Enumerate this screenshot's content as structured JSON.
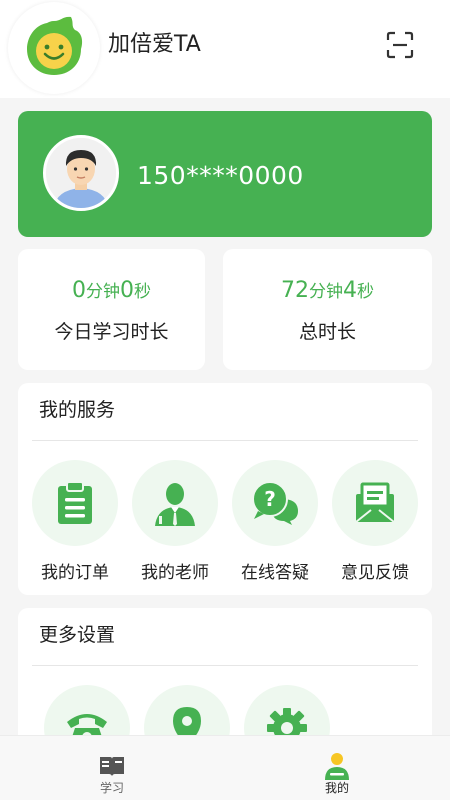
{
  "header": {
    "app_title": "加倍爱TA",
    "scan_icon": "scan-icon"
  },
  "profile": {
    "phone": "150****0000",
    "avatar_icon": "user-avatar"
  },
  "stats": {
    "today": {
      "minutes": "0",
      "minutes_unit": "分钟",
      "seconds": "0",
      "seconds_unit": "秒",
      "label": "今日学习时长"
    },
    "total": {
      "minutes": "72",
      "minutes_unit": "分钟",
      "seconds": "4",
      "seconds_unit": "秒",
      "label": "总时长"
    }
  },
  "services": {
    "title": "我的服务",
    "items": [
      {
        "label": "我的订单",
        "icon": "clipboard-icon"
      },
      {
        "label": "我的老师",
        "icon": "teacher-icon"
      },
      {
        "label": "在线答疑",
        "icon": "question-chat-icon"
      },
      {
        "label": "意见反馈",
        "icon": "feedback-mail-icon"
      }
    ]
  },
  "settings": {
    "title": "更多设置",
    "items": [
      {
        "icon": "phone-icon"
      },
      {
        "icon": "location-pin-icon"
      },
      {
        "icon": "gear-icon"
      }
    ]
  },
  "tabbar": {
    "items": [
      {
        "label": "学习",
        "icon": "book-icon",
        "active": false
      },
      {
        "label": "我的",
        "icon": "user-icon",
        "active": true
      }
    ]
  },
  "colors": {
    "accent": "#46b152",
    "accent_light": "#eef8ef",
    "text": "#222222",
    "tab_inactive": "#666666",
    "tab_active": "#222222"
  }
}
